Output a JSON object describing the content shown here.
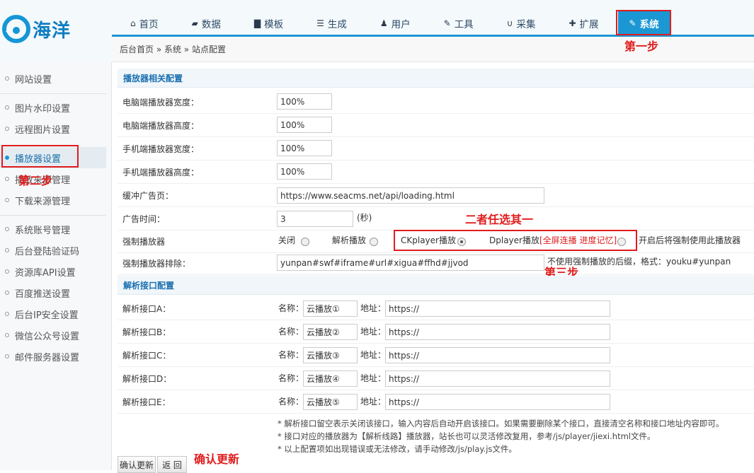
{
  "brand": {
    "name": "海洋"
  },
  "nav": [
    {
      "label": "首页",
      "icon": "home-icon",
      "glyph": "⌂"
    },
    {
      "label": "数据",
      "icon": "book-icon",
      "glyph": "▰"
    },
    {
      "label": "模板",
      "icon": "file-icon",
      "glyph": "▇"
    },
    {
      "label": "生成",
      "icon": "server-icon",
      "glyph": "☰"
    },
    {
      "label": "用户",
      "icon": "user-icon",
      "glyph": "♟"
    },
    {
      "label": "工具",
      "icon": "wrench-icon",
      "glyph": "✎"
    },
    {
      "label": "采集",
      "icon": "magnet-icon",
      "glyph": "∪"
    },
    {
      "label": "扩展",
      "icon": "puzzle-icon",
      "glyph": "✚"
    },
    {
      "label": "系统",
      "icon": "edit-icon",
      "glyph": "✎"
    }
  ],
  "breadcrumb": "后台首页 » 系统 » 站点配置",
  "sidebar": {
    "group1": [
      "网站设置"
    ],
    "group2": [
      "图片水印设置",
      "远程图片设置",
      "播放器设置",
      "播放来源管理",
      "下载来源管理"
    ],
    "group3": [
      "系统账号管理",
      "后台登陆验证码",
      "资源库API设置",
      "百度推送设置",
      "后台IP安全设置",
      "微信公众号设置",
      "邮件服务器设置"
    ]
  },
  "annotations": {
    "step1": "第一步",
    "step2": "第二步",
    "step3": "第三步",
    "choose": "二者任选其一",
    "confirm": "确认更新"
  },
  "player_section": {
    "title": "播放器相关配置",
    "pc_width_label": "电脑端播放器宽度：",
    "pc_width": "100%",
    "pc_height_label": "电脑端播放器高度：",
    "pc_height": "100%",
    "m_width_label": "手机端播放器宽度：",
    "m_width": "100%",
    "m_height_label": "手机端播放器高度：",
    "m_height": "100%",
    "buffer_label": "缓冲广告页：",
    "buffer_url": "https://www.seacms.net/api/loading.html",
    "ad_time_label": "广告时间：",
    "ad_time": "3",
    "ad_time_unit": "(秒)",
    "force_label": "强制播放器",
    "force_opts": {
      "off": "关闭",
      "parse": "解析播放",
      "ck": "CKplayer播放",
      "dp": "Dplayer播放",
      "dp_extra": "[全屏连播 进度记忆]"
    },
    "force_note": "开启后将强制使用此播放器",
    "exclude_label": "强制播放器排除：",
    "exclude_value": "yunpan#swf#iframe#url#xigua#ffhd#jjvod",
    "exclude_note": "不使用强制播放的后缀，格式：youku#yunpan"
  },
  "parse_section": {
    "title": "解析接口配置",
    "name_label": "名称：",
    "addr_label": "地址：",
    "rows": [
      {
        "label": "解析接口A：",
        "name": "云播放①",
        "addr": "https://"
      },
      {
        "label": "解析接口B：",
        "name": "云播放②",
        "addr": "https://"
      },
      {
        "label": "解析接口C：",
        "name": "云播放③",
        "addr": "https://"
      },
      {
        "label": "解析接口D：",
        "name": "云播放④",
        "addr": "https://"
      },
      {
        "label": "解析接口E：",
        "name": "云播放⑤",
        "addr": "https://"
      }
    ],
    "notes": [
      "* 解析接口留空表示关闭该接口，输入内容后自动开启该接口。如果需要删除某个接口，直接清空名称和接口地址内容即可。",
      "* 接口对应的播放器为【解析线路】播放器，站长也可以灵活修改复用，参考/js/player/jiexi.html文件。",
      "* 以上配置项如出现错误或无法修改，请手动修改/js/play.js文件。"
    ]
  },
  "buttons": {
    "confirm": "确认更新",
    "back": "返 回"
  },
  "colors": {
    "accent": "#1b97d4",
    "annotation": "#e01c1c",
    "section_title": "#1a6fb0"
  }
}
